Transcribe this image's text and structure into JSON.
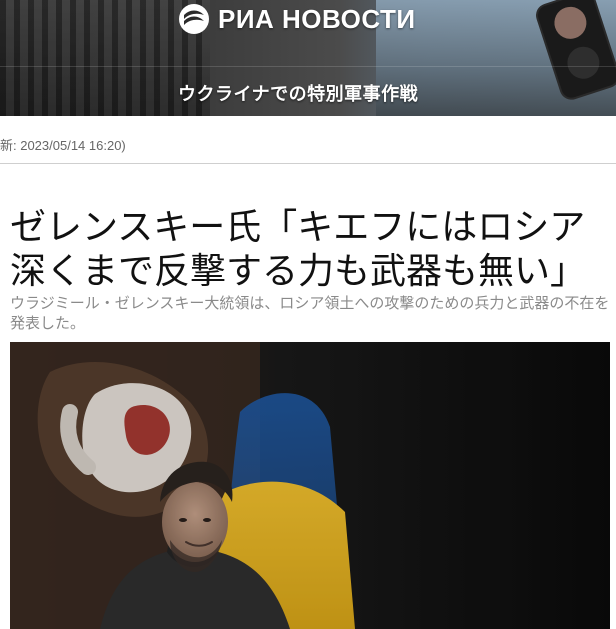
{
  "header": {
    "logo_text": "РИА НОВОСТИ",
    "section_title": "ウクライナでの特別軍事作戦"
  },
  "article": {
    "meta": "新: 2023/05/14 16:20)",
    "headline": "ゼレンスキー氏「キエフにはロシア深くまで反撃する力も武器も無い」",
    "lead": "ウラジミール・ゼレンスキー大統領は、ロシア領土への攻撃のための兵力と武器の不在を発表した。"
  },
  "photo": {
    "subject": "portrait-photo"
  },
  "colors": {
    "header_bg": "#3a3a3a",
    "headline": "#111111",
    "lead": "#8a8a8a",
    "meta": "#666666",
    "rule": "#cfcfcf",
    "flag_blue": "#1f5aa6",
    "flag_yellow": "#f2c12e"
  },
  "icons": {
    "logo": "ria-novosti-logo-icon"
  }
}
